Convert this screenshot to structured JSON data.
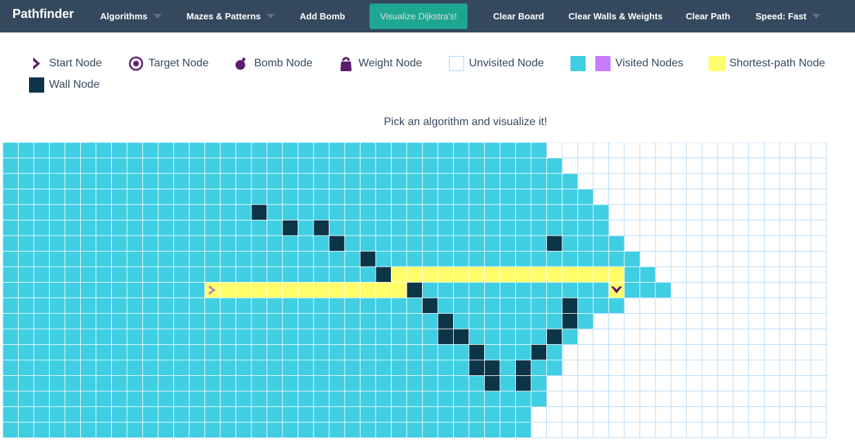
{
  "navbar": {
    "brand": "Pathfinder",
    "algorithms": "Algorithms",
    "mazes": "Mazes & Patterns",
    "add_bomb": "Add Bomb",
    "visualize": "Visualize Dijkstra's!",
    "clear_board": "Clear Board",
    "clear_walls": "Clear Walls & Weights",
    "clear_path": "Clear Path",
    "speed": "Speed: Fast"
  },
  "legend": {
    "start": "Start Node",
    "target": "Target Node",
    "bomb": "Bomb Node",
    "weight": "Weight Node",
    "unvisited": "Unvisited Node",
    "visited": "Visited Nodes",
    "shortest": "Shortest-path Node",
    "wall": "Wall Node"
  },
  "instructions": "Pick an algorithm and visualize it!",
  "colors": {
    "navbar": "#34495e",
    "visualize_button": "#1abc9c",
    "visited": "#40cee3",
    "visited_alt": "#c77dff",
    "shortest_path": "#fffe6a",
    "wall": "#0c3547",
    "unvisited_border": "#afd8f8",
    "start_target": "#5b1b6e",
    "start_on_path": "#b48bb0"
  },
  "grid": {
    "rows": 19,
    "cols": 53,
    "start": [
      9,
      13
    ],
    "target": [
      9,
      39
    ],
    "visited_extent": [
      34,
      35,
      36,
      37,
      38,
      38,
      39,
      40,
      41,
      42,
      39,
      37,
      36,
      35,
      35,
      34,
      34,
      33,
      33
    ],
    "walls": [
      [
        4,
        16
      ],
      [
        5,
        18
      ],
      [
        5,
        20
      ],
      [
        6,
        21
      ],
      [
        6,
        35
      ],
      [
        7,
        23
      ],
      [
        8,
        24
      ],
      [
        9,
        26
      ],
      [
        10,
        27
      ],
      [
        10,
        36
      ],
      [
        11,
        28
      ],
      [
        11,
        36
      ],
      [
        12,
        28
      ],
      [
        12,
        29
      ],
      [
        12,
        35
      ],
      [
        13,
        30
      ],
      [
        13,
        34
      ],
      [
        14,
        30
      ],
      [
        14,
        31
      ],
      [
        14,
        33
      ],
      [
        15,
        31
      ],
      [
        15,
        33
      ]
    ],
    "path": [
      [
        9,
        13
      ],
      [
        9,
        14
      ],
      [
        9,
        15
      ],
      [
        9,
        16
      ],
      [
        9,
        17
      ],
      [
        9,
        18
      ],
      [
        9,
        19
      ],
      [
        9,
        20
      ],
      [
        9,
        21
      ],
      [
        9,
        22
      ],
      [
        9,
        23
      ],
      [
        9,
        24
      ],
      [
        9,
        25
      ],
      [
        8,
        25
      ],
      [
        8,
        26
      ],
      [
        8,
        27
      ],
      [
        8,
        28
      ],
      [
        8,
        29
      ],
      [
        8,
        30
      ],
      [
        8,
        31
      ],
      [
        8,
        32
      ],
      [
        8,
        33
      ],
      [
        8,
        34
      ],
      [
        8,
        35
      ],
      [
        8,
        36
      ],
      [
        8,
        37
      ],
      [
        8,
        38
      ],
      [
        8,
        39
      ],
      [
        9,
        39
      ]
    ]
  }
}
